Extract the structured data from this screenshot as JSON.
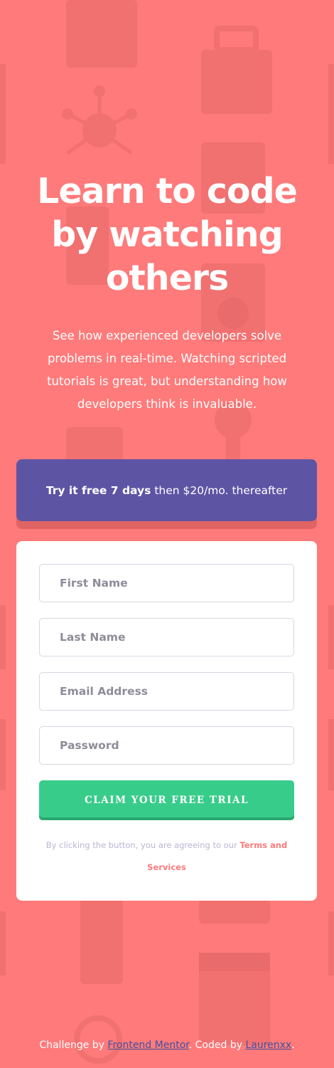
{
  "hero": {
    "title": "Learn to code by watching others",
    "description": "See how experienced developers solve problems in real-time. Watching scripted tutorials is great, but understanding how developers think is invaluable."
  },
  "promo": {
    "strong": "Try it free 7 days",
    "rest": "then $20/mo. thereafter"
  },
  "form": {
    "first_name_placeholder": "First Name",
    "last_name_placeholder": "Last Name",
    "email_placeholder": "Email Address",
    "password_placeholder": "Password",
    "submit_label": "CLAIM YOUR FREE TRIAL",
    "terms_prefix": "By clicking the button, you are agreeing to our ",
    "terms_link": "Terms and Services"
  },
  "footer": {
    "challenge_prefix": "Challenge by ",
    "frontend_mentor_link": "Frontend Mentor",
    "coded_by_text": ". Coded by ",
    "author_link": "Laurenxx",
    "suffix": "."
  },
  "colors": {
    "background": "#ff7a7a",
    "promo": "#5e54a4",
    "submit": "#38cc8b",
    "link": "#ff7a7a",
    "footer_link": "#3e52a3"
  }
}
